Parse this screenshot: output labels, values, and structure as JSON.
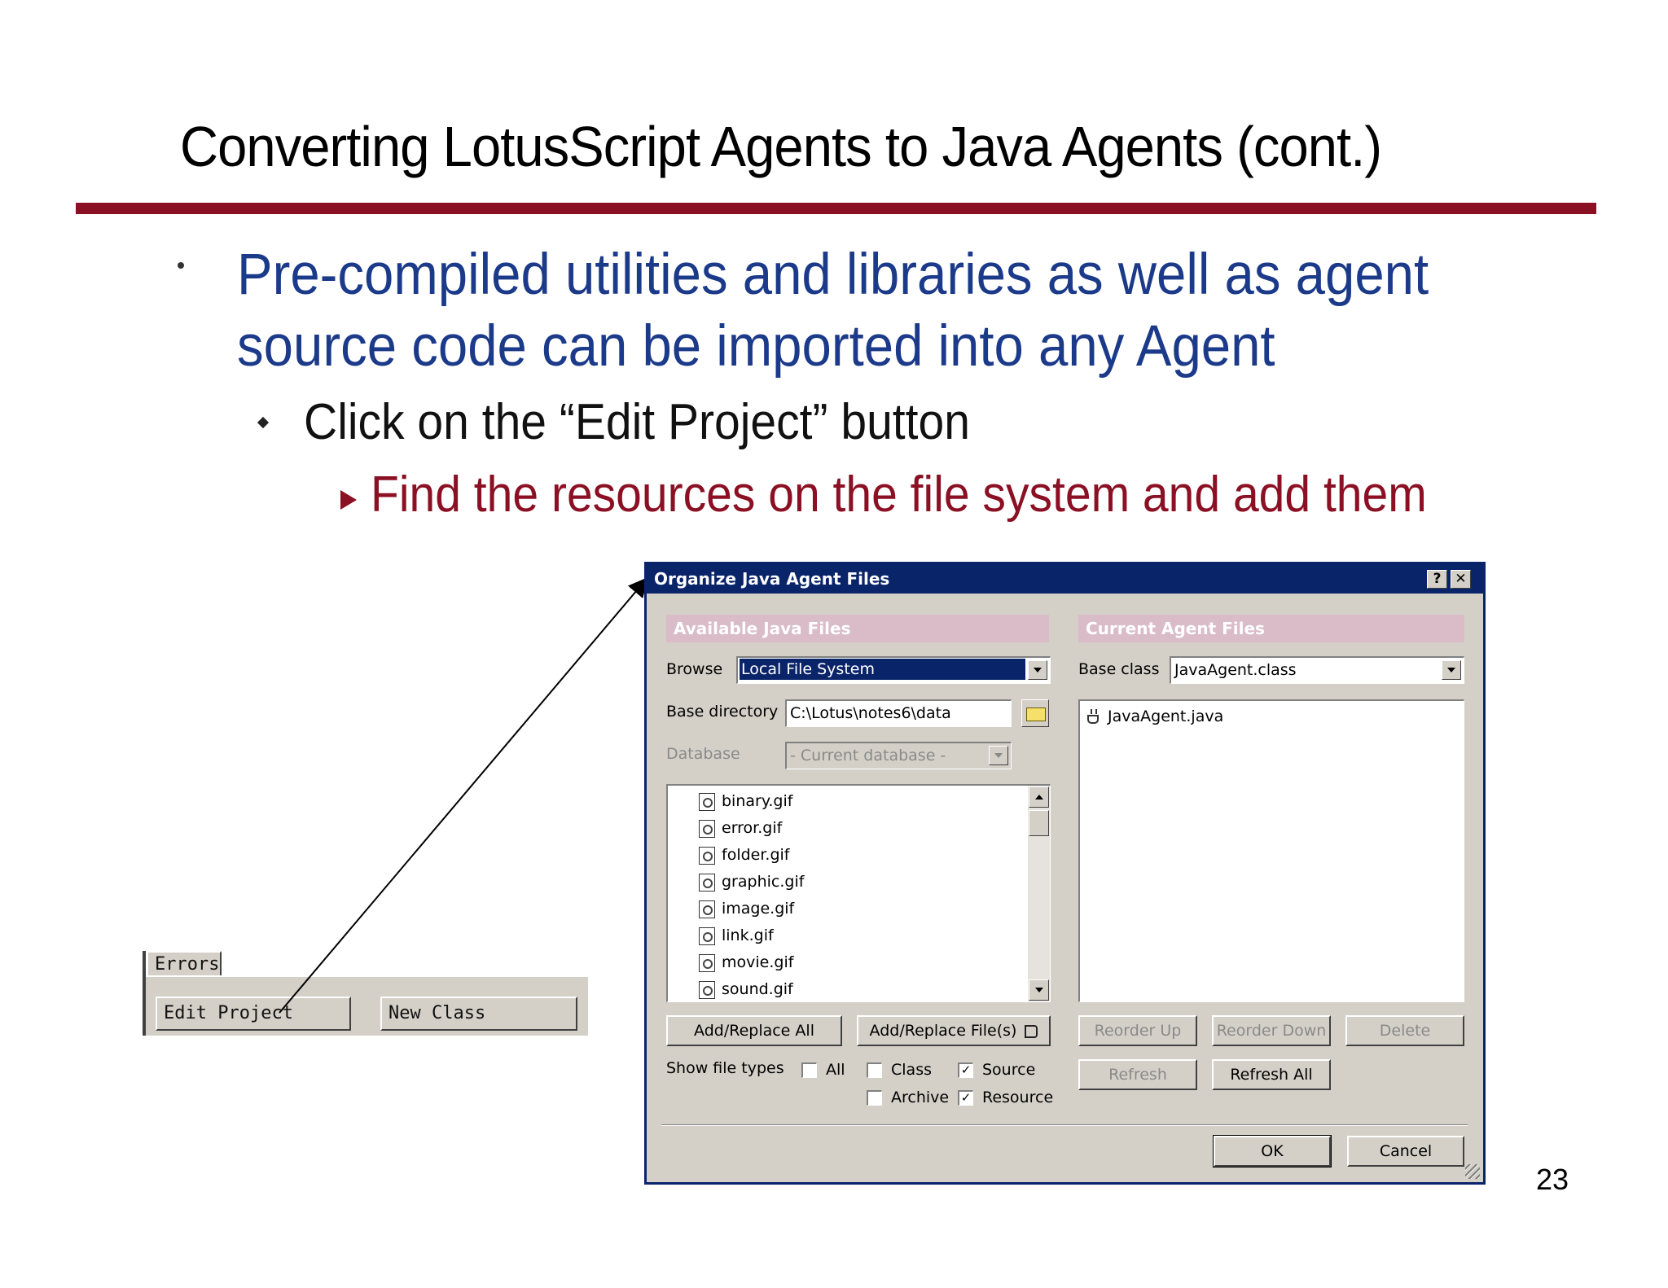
{
  "slide": {
    "title": "Converting LotusScript Agents to Java Agents (cont.)",
    "bullet1_line1": "Pre-compiled utilities and libraries as well as agent",
    "bullet1_line2": "source code can be imported into any Agent",
    "bullet2": "Click on the “Edit Project” button",
    "bullet3": "Find the resources on the file system and add them",
    "page_number": "23",
    "accent_color": "#8b1023",
    "bullet_color": "#1c3a8a"
  },
  "mini_toolbar": {
    "tab": "Errors",
    "edit_project": "Edit Project",
    "new_class": "New Class"
  },
  "dialog": {
    "title": "Organize Java Agent Files",
    "help_glyph": "?",
    "close_glyph": "✕",
    "available": {
      "header": "Available Java Files",
      "browse_label": "Browse",
      "browse_value": "Local File System",
      "base_dir_label": "Base directory",
      "base_dir_value": "C:\\Lotus\\notes6\\data",
      "database_label": "Database",
      "database_value": "- Current database -",
      "files": [
        "binary.gif",
        "error.gif",
        "folder.gif",
        "graphic.gif",
        "image.gif",
        "link.gif",
        "movie.gif",
        "sound.gif"
      ],
      "add_replace_all": "Add/Replace All",
      "add_replace_files": "Add/Replace File(s)",
      "show_file_types": "Show file types",
      "types": {
        "all": "All",
        "class": "Class",
        "source": "Source",
        "archive": "Archive",
        "resource": "Resource"
      },
      "check_mark": "✓"
    },
    "current": {
      "header": "Current Agent Files",
      "base_class_label": "Base class",
      "base_class_value": "JavaAgent.class",
      "files": [
        "JavaAgent.java"
      ],
      "reorder_up": "Reorder Up",
      "reorder_down": "Reorder Down",
      "delete": "Delete",
      "refresh": "Refresh",
      "refresh_all": "Refresh All"
    },
    "ok": "OK",
    "cancel": "Cancel"
  }
}
